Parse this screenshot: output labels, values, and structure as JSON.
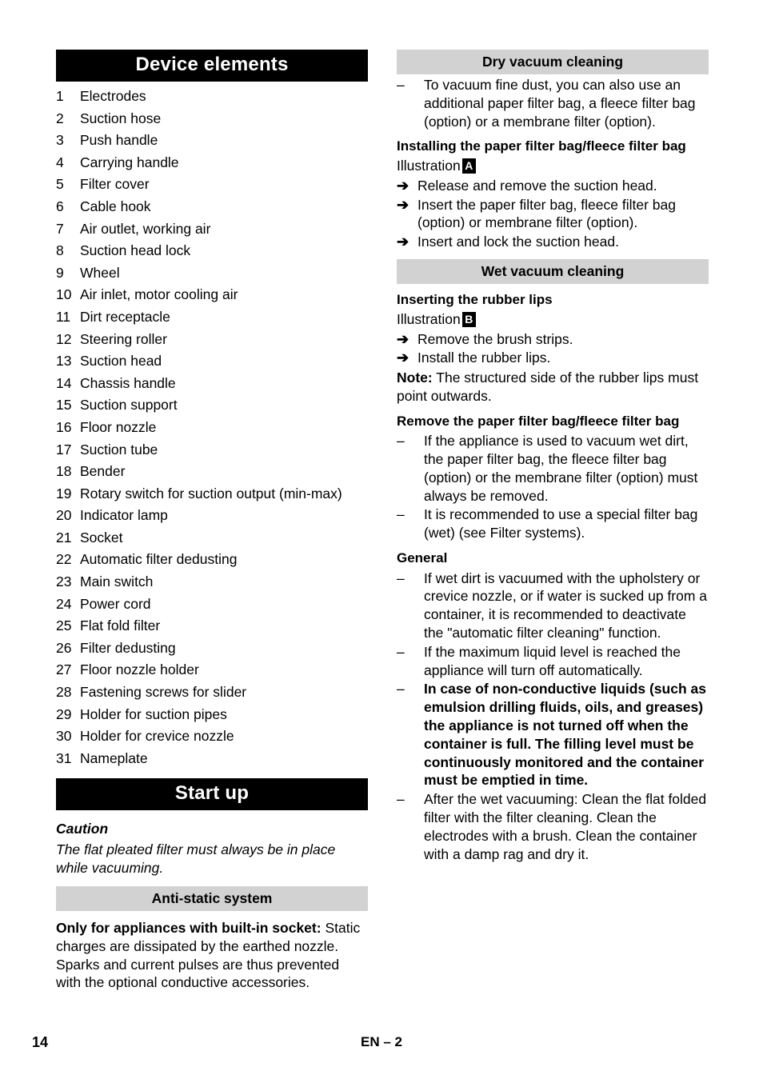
{
  "document": {
    "page_number": "14",
    "language_footer": "EN – 2"
  },
  "left_column": {
    "device_elements": {
      "heading": "Device elements",
      "items": [
        {
          "num": "1",
          "label": "Electrodes"
        },
        {
          "num": "2",
          "label": "Suction hose"
        },
        {
          "num": "3",
          "label": "Push handle"
        },
        {
          "num": "4",
          "label": "Carrying handle"
        },
        {
          "num": "5",
          "label": "Filter cover"
        },
        {
          "num": "6",
          "label": "Cable hook"
        },
        {
          "num": "7",
          "label": "Air outlet, working air"
        },
        {
          "num": "8",
          "label": "Suction head lock"
        },
        {
          "num": "9",
          "label": "Wheel"
        },
        {
          "num": "10",
          "label": "Air inlet, motor cooling air"
        },
        {
          "num": "11",
          "label": "Dirt receptacle"
        },
        {
          "num": "12",
          "label": "Steering roller"
        },
        {
          "num": "13",
          "label": "Suction head"
        },
        {
          "num": "14",
          "label": "Chassis handle"
        },
        {
          "num": "15",
          "label": "Suction support"
        },
        {
          "num": "16",
          "label": "Floor nozzle"
        },
        {
          "num": "17",
          "label": "Suction tube"
        },
        {
          "num": "18",
          "label": "Bender"
        },
        {
          "num": "19",
          "label": "Rotary switch for suction output (min-max)"
        },
        {
          "num": "20",
          "label": "Indicator lamp"
        },
        {
          "num": "21",
          "label": "Socket"
        },
        {
          "num": "22",
          "label": "Automatic filter dedusting"
        },
        {
          "num": "23",
          "label": "Main switch"
        },
        {
          "num": "24",
          "label": "Power cord"
        },
        {
          "num": "25",
          "label": "Flat fold filter"
        },
        {
          "num": "26",
          "label": "Filter dedusting"
        },
        {
          "num": "27",
          "label": "Floor nozzle holder"
        },
        {
          "num": "28",
          "label": "Fastening screws for slider"
        },
        {
          "num": "29",
          "label": "Holder for suction pipes"
        },
        {
          "num": "30",
          "label": "Holder for crevice nozzle"
        },
        {
          "num": "31",
          "label": "Nameplate"
        }
      ]
    },
    "start_up": {
      "heading": "Start up",
      "caution_label": "Caution",
      "caution_text": "The flat pleated filter must always be in place while vacuuming.",
      "anti_static": {
        "heading": "Anti-static system",
        "lead_bold": "Only for appliances with built-in socket:",
        "body": "Static charges are dissipated by the earthed nozzle. Sparks and current pulses are thus prevented with the optional conductive accessories."
      }
    }
  },
  "right_column": {
    "dry_vacuum": {
      "heading": "Dry vacuum cleaning",
      "bullets": [
        "To vacuum fine dust, you can also use an additional paper filter bag, a fleece filter bag (option) or a membrane filter (option)."
      ],
      "installing": {
        "heading": "Installing the paper filter bag/fleece filter bag",
        "illustration_label": "Illustration",
        "illustration_badge": "A",
        "steps": [
          "Release and remove the suction head.",
          "Insert the paper filter bag, fleece filter bag (option) or membrane filter (option).",
          "Insert and lock the suction head."
        ]
      }
    },
    "wet_vacuum": {
      "heading": "Wet vacuum cleaning",
      "inserting_lips": {
        "heading": "Inserting the rubber lips",
        "illustration_label": "Illustration",
        "illustration_badge": "B",
        "steps": [
          "Remove the brush strips.",
          "Install the rubber lips."
        ],
        "note_label": "Note:",
        "note_text": "The structured side of the rubber lips must point outwards."
      },
      "remove_bag": {
        "heading": "Remove the paper filter bag/fleece filter bag",
        "bullets": [
          "If the appliance is used to vacuum wet dirt,  the paper filter bag, the fleece filter bag (option) or the membrane filter (option) must always be removed.",
          "It is recommended to use a special filter bag (wet) (see Filter systems)."
        ]
      },
      "general": {
        "heading": "General",
        "bullets": [
          {
            "text": "If wet dirt is vacuumed with the upholstery or crevice nozzle, or if water is sucked up from a container, it is recommended to deactivate the \"automatic filter cleaning\" function.",
            "bold": false
          },
          {
            "text": "If the maximum liquid level is reached the appliance will turn off automatically.",
            "bold": false
          },
          {
            "text": "In case of non-conductive liquids (such as emulsion drilling fluids, oils, and greases) the appliance is not turned off when the container is full. The filling level must be continuously monitored and the container must be emptied in time.",
            "bold": true
          },
          {
            "text": "After the wet vacuuming: Clean the flat folded filter with the filter cleaning. Clean the electrodes with a brush. Clean the container with a damp rag and dry it.",
            "bold": false
          }
        ]
      }
    }
  },
  "icons": {
    "arrow": "➔",
    "dash": "–"
  },
  "colors": {
    "heading_black_bg": "#000000",
    "heading_black_fg": "#ffffff",
    "heading_gray_bg": "#d2d2d2",
    "text": "#000000",
    "page_bg": "#ffffff"
  }
}
